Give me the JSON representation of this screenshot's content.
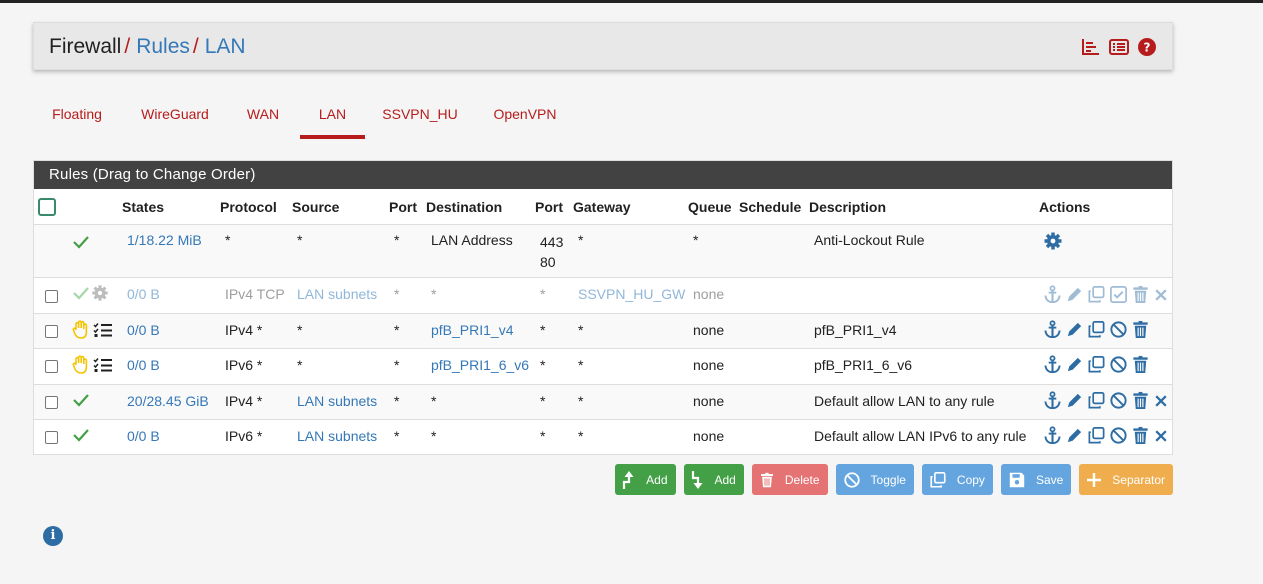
{
  "breadcrumb": {
    "root": "Firewall",
    "sep": "/",
    "level1": "Rules",
    "level2": "LAN"
  },
  "header_icons": [
    "chart-icon",
    "list-icon",
    "help-icon"
  ],
  "tabs": [
    {
      "label": "Floating",
      "active": false
    },
    {
      "label": "WireGuard",
      "active": false
    },
    {
      "label": "WAN",
      "active": false
    },
    {
      "label": "LAN",
      "active": true
    },
    {
      "label": "SSVPN_HU",
      "active": false
    },
    {
      "label": "OpenVPN",
      "active": false
    }
  ],
  "panel": {
    "title": "Rules (Drag to Change Order)"
  },
  "columns": {
    "states": "States",
    "protocol": "Protocol",
    "source": "Source",
    "port": "Port",
    "destination": "Destination",
    "dport": "Port",
    "gateway": "Gateway",
    "queue": "Queue",
    "schedule": "Schedule",
    "description": "Description",
    "actions": "Actions"
  },
  "rows": [
    {
      "states": "1/18.22 MiB",
      "protocol": "*",
      "source": "*",
      "port": "*",
      "destination": "LAN Address",
      "dport_line1": "443",
      "dport_line2": "80",
      "gateway": "*",
      "queue": "*",
      "schedule": "",
      "description": "Anti-Lockout Rule"
    },
    {
      "states": "0/0 B",
      "protocol": "IPv4 TCP",
      "source": "LAN subnets",
      "port": "*",
      "destination": "*",
      "dport": "*",
      "gateway": "SSVPN_HU_GW",
      "queue": "none",
      "schedule": "",
      "description": ""
    },
    {
      "states": "0/0 B",
      "protocol": "IPv4 *",
      "source": "*",
      "port": "*",
      "destination": "pfB_PRI1_v4",
      "dport": "*",
      "gateway": "*",
      "queue": "none",
      "schedule": "",
      "description": "pfB_PRI1_v4"
    },
    {
      "states": "0/0 B",
      "protocol": "IPv6 *",
      "source": "*",
      "port": "*",
      "destination": "pfB_PRI1_6_v6",
      "dport": "*",
      "gateway": "*",
      "queue": "none",
      "schedule": "",
      "description": "pfB_PRI1_6_v6"
    },
    {
      "states": "20/28.45 GiB",
      "protocol": "IPv4 *",
      "source": "LAN subnets",
      "port": "*",
      "destination": "*",
      "dport": "*",
      "gateway": "*",
      "queue": "none",
      "schedule": "",
      "description": "Default allow LAN to any rule"
    },
    {
      "states": "0/0 B",
      "protocol": "IPv6 *",
      "source": "LAN subnets",
      "port": "*",
      "destination": "*",
      "dport": "*",
      "gateway": "*",
      "queue": "none",
      "schedule": "",
      "description": "Default allow LAN IPv6 to any rule"
    }
  ],
  "buttons": {
    "add_top": "Add",
    "add_bottom": "Add",
    "delete": "Delete",
    "toggle": "Toggle",
    "copy": "Copy",
    "save": "Save",
    "separator": "Separator"
  },
  "colors": {
    "accent": "#b71c1c",
    "link": "#3578b8",
    "panel_header": "#424242",
    "green": "#43a047"
  }
}
